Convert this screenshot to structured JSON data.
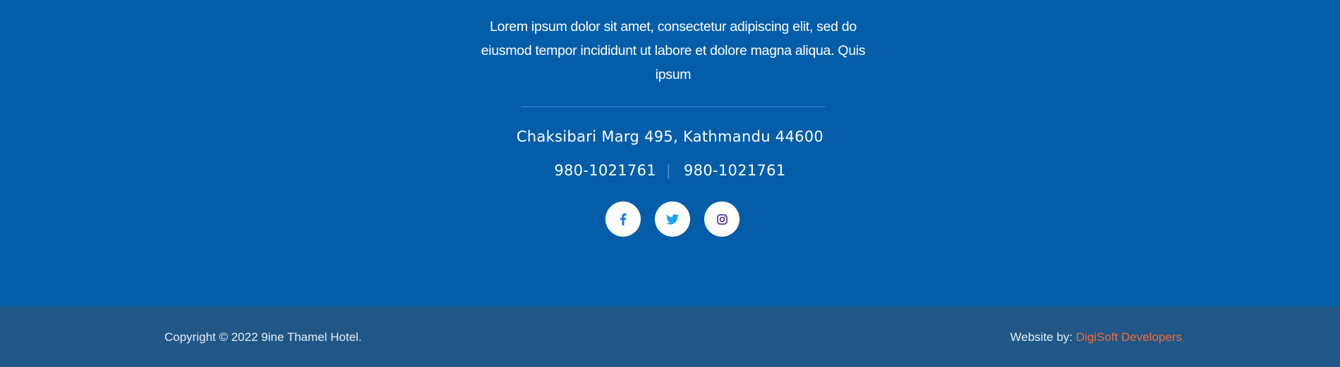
{
  "footer": {
    "about_text": "Lorem ipsum dolor sit amet, consectetur adipiscing elit, sed do eiusmod tempor incididunt ut labore et dolore magna aliqua. Quis ipsum",
    "address": "Chaksibari Marg 495, Kathmandu 44600",
    "phone_1": "980-1021761",
    "phone_separator": "|",
    "phone_2": "980-1021761",
    "socials": [
      {
        "name": "facebook",
        "icon": "facebook-icon",
        "color": "#1877f2"
      },
      {
        "name": "twitter",
        "icon": "twitter-icon",
        "color": "#1da1f2"
      },
      {
        "name": "instagram",
        "icon": "instagram-icon",
        "color": "#3b1e8f"
      }
    ],
    "background_color": "#035da9"
  },
  "bottom_bar": {
    "copyright": "Copyright © 2022 9ine Thamel Hotel.",
    "credit_label": "Website by: ",
    "credit_link": "DigiSoft Developers",
    "background_color": "#205787",
    "link_color": "#f26a3a"
  }
}
